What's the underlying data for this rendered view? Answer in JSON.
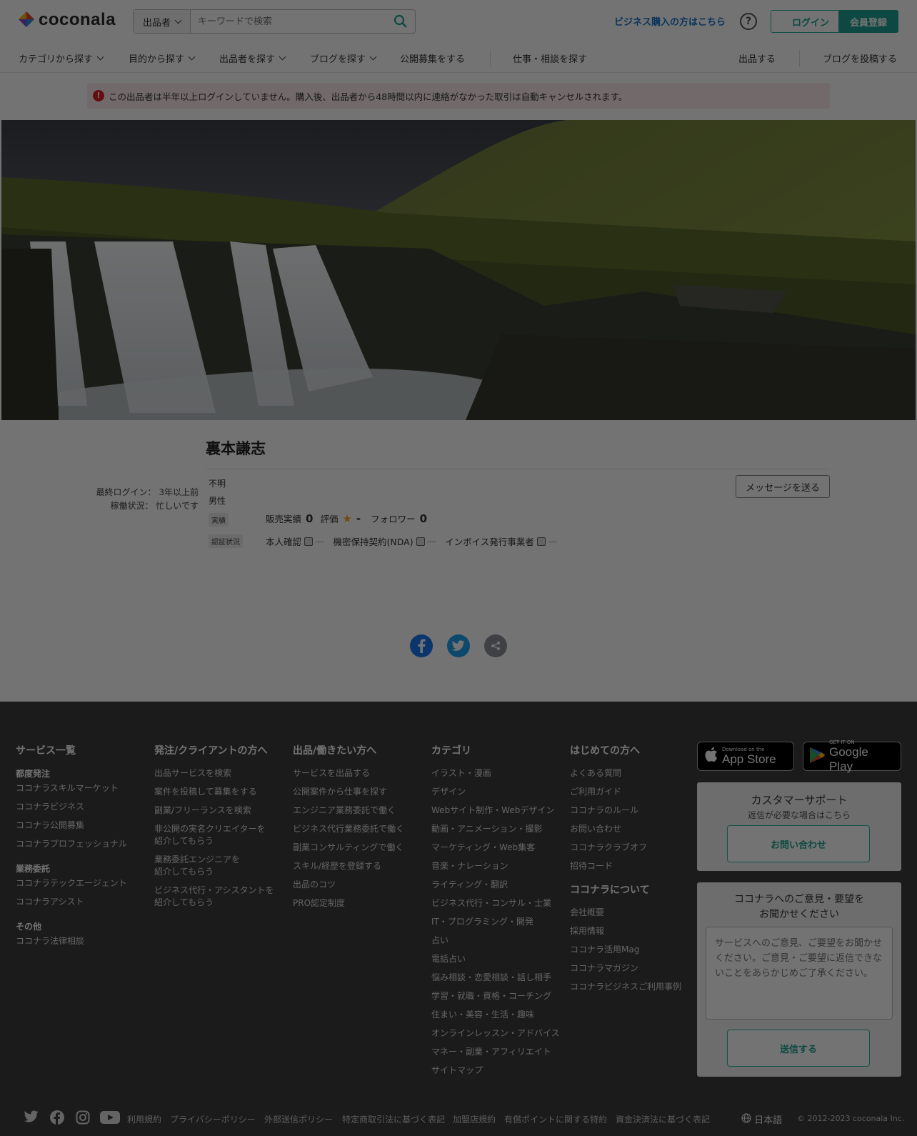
{
  "header": {
    "logo_text": "coconala",
    "search_scope": "出品者",
    "search_placeholder": "キーワードで検索",
    "business_link": "ビジネス購入の方はこちら",
    "help_label": "?",
    "login": "ログイン",
    "signup": "会員登録"
  },
  "nav": {
    "category": "カテゴリから探す",
    "purpose": "目的から探す",
    "sellers": "出品者を探す",
    "blogs": "ブログを探す",
    "public_recruit": "公開募集をする",
    "find_jobs": "仕事・相談を探す",
    "sell": "出品する",
    "post_blog": "ブログを投稿する"
  },
  "alert": {
    "text": "この出品者は半年以上ログインしていません。購入後、出品者から48時間以内に連絡がなかった取引は自動キャンセルされます。"
  },
  "profile": {
    "name": "裏本謙志",
    "last_login": "最終ログイン： 3年以上前",
    "work_status": "稼働状況： 忙しいです",
    "age": "不明",
    "gender": "男性",
    "record_tag": "実績",
    "sales_label": "販売実績",
    "sales_value": "0",
    "rating_label": "評価",
    "rating_value": "-",
    "followers_label": "フォロワー",
    "followers_value": "0",
    "verify_tag": "認証状況",
    "identity": "本人確認",
    "identity_status": "—",
    "nda": "機密保持契約(NDA)",
    "nda_status": "—",
    "invoice": "インボイス発行事業者",
    "invoice_status": "—",
    "message_button": "メッセージを送る"
  },
  "footer": {
    "col1": {
      "title": "サービス一覧",
      "sub1": "都度発注",
      "links1": [
        "ココナラスキルマーケット",
        "ココナラビジネス",
        "ココナラ公開募集",
        "ココナラプロフェッショナル"
      ],
      "sub2": "業務委託",
      "links2": [
        "ココナラテックエージェント",
        "ココナラアシスト"
      ],
      "sub3": "その他",
      "links3": [
        "ココナラ法律相談"
      ]
    },
    "col2": {
      "title": "発注/クライアントの方へ",
      "links": [
        "出品サービスを検索",
        "案件を投稿して募集をする",
        "副業/フリーランスを検索",
        "非公開の実名クリエイターを\n紹介してもらう",
        "業務委託エンジニアを\n紹介してもらう",
        "ビジネス代行・アシスタントを\n紹介してもらう"
      ]
    },
    "col3": {
      "title": "出品/働きたい方へ",
      "links": [
        "サービスを出品する",
        "公開案件から仕事を探す",
        "エンジニア業務委託で働く",
        "ビジネス代行業務委託で働く",
        "副業コンサルティングで働く",
        "スキル/経歴を登録する",
        "出品のコツ",
        "PRO認定制度"
      ]
    },
    "col4": {
      "title": "カテゴリ",
      "links": [
        "イラスト・漫画",
        "デザイン",
        "Webサイト制作・Webデザイン",
        "動画・アニメーション・撮影",
        "マーケティング・Web集客",
        "音楽・ナレーション",
        "ライティング・翻訳",
        "ビジネス代行・コンサル・士業",
        "IT・プログラミング・開発",
        "占い",
        "電話占い",
        "悩み相談・恋愛相談・話し相手",
        "学習・就職・資格・コーチング",
        "住まい・美容・生活・趣味",
        "オンラインレッスン・アドバイス",
        "マネー・副業・アフィリエイト",
        "サイトマップ"
      ]
    },
    "col5": {
      "title": "はじめての方へ",
      "links": [
        "よくある質問",
        "ご利用ガイド",
        "ココナラのルール",
        "お問い合わせ",
        "ココナラクラブオフ",
        "招待コード"
      ],
      "title2": "ココナラについて",
      "links2": [
        "会社概要",
        "採用情報",
        "ココナラ活用Mag",
        "ココナラマガジン",
        "ココナラビジネスご利用事例"
      ]
    },
    "appstore_small": "Download on the",
    "appstore_big": "App Store",
    "googleplay_small": "GET IT ON",
    "googleplay_big": "Google Play",
    "support_title": "カスタマーサポート",
    "support_sub": "返信が必要な場合はこちら",
    "support_button": "お問い合わせ",
    "feedback_title": "ココナラへのご意見・要望を\nお聞かせください",
    "feedback_placeholder": "サービスへのご意見、ご要望をお聞かせください。ご意見・ご要望に返信できないことをあらかじめご了承ください。",
    "feedback_button": "送信する",
    "bottom_links": [
      "利用規約",
      "プライバシーポリシー",
      "外部送信ポリシー",
      "特定商取引法に基づく表記",
      "加盟店規約",
      "有償ポイントに関する特約",
      "資金決済法に基づく表記"
    ],
    "language": "日本語",
    "copyright": "© 2012-2023 coconala Inc."
  },
  "colors": {
    "accent": "#1ea293",
    "link_blue": "#1a73c9",
    "alert_bg": "#fde9ec",
    "footer_bg": "#3c3c3c"
  }
}
